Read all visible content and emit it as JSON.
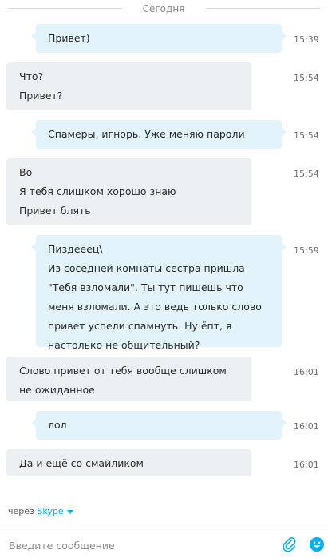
{
  "day_separator": "Сегодня",
  "messages": [
    {
      "direction": "out",
      "lines": [
        "Привет)"
      ],
      "time": "15:39"
    },
    {
      "direction": "in",
      "lines": [
        "Что?",
        "Привет?"
      ],
      "time": "15:54"
    },
    {
      "direction": "out",
      "lines": [
        "Спамеры, игнорь. Уже меняю пароли"
      ],
      "time": "15:54"
    },
    {
      "direction": "in",
      "lines": [
        "Во",
        "Я тебя слишком хорошо знаю",
        "Привет блять"
      ],
      "time": "15:54"
    },
    {
      "direction": "out",
      "lines": [
        "Пиздееец\\",
        "Из соседней комнаты сестра пришла",
        "\"Тебя взломали\". Ты тут пишешь что",
        "меня взломали. А это ведь только слово",
        "привет успели спамнуть. Ну ёпт, я",
        "настолько не общительный?"
      ],
      "time": "15:59"
    },
    {
      "direction": "in",
      "lines": [
        "Слово привет от тебя вообще слишком",
        "не ожиданное"
      ],
      "time": "16:01"
    },
    {
      "direction": "out",
      "lines": [
        "лол"
      ],
      "time": "16:01"
    },
    {
      "direction": "in",
      "lines": [
        "Да и ещё со смайликом"
      ],
      "time": "16:01"
    }
  ],
  "via": {
    "prefix": "через",
    "link": "Skype"
  },
  "composer": {
    "placeholder": "Введите сообщение"
  },
  "icons": {
    "attach": "paperclip-icon",
    "emoji": "emoticon-icon"
  },
  "colors": {
    "accent": "#00aff0",
    "incoming_bubble": "#edf0f3",
    "outgoing_bubble": "#e2f3fc"
  }
}
